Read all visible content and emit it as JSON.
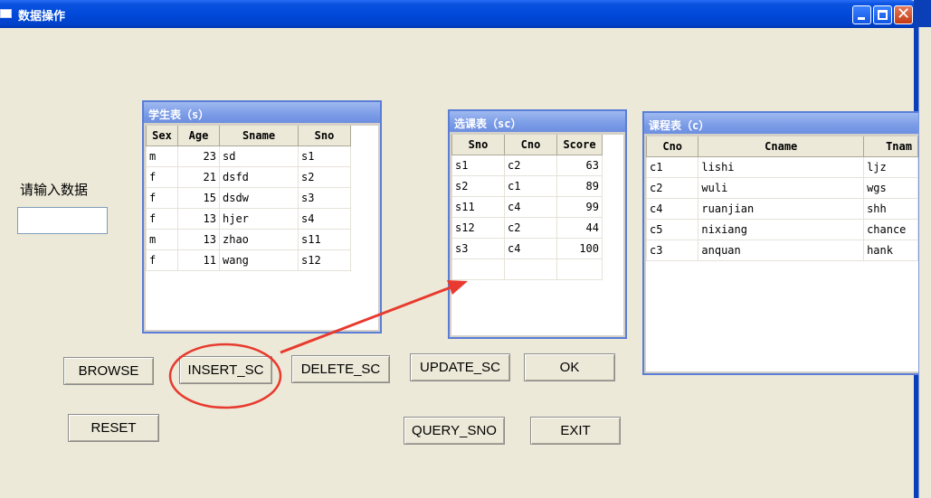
{
  "window": {
    "title": "数据操作"
  },
  "label_input": "请输入数据",
  "student": {
    "title": "学生表（s）",
    "headers": [
      "Sex",
      "Age",
      "Sname",
      "Sno"
    ],
    "rows": [
      [
        "m",
        "23",
        "sd",
        "s1"
      ],
      [
        "f",
        "21",
        "dsfd",
        "s2"
      ],
      [
        "f",
        "15",
        "dsdw",
        "s3"
      ],
      [
        "f",
        "13",
        "hjer",
        "s4"
      ],
      [
        "m",
        "13",
        "zhao",
        "s11"
      ],
      [
        "f",
        "11",
        "wang",
        "s12"
      ]
    ]
  },
  "sc": {
    "title": "选课表（sc）",
    "headers": [
      "Sno",
      "Cno",
      "Score"
    ],
    "rows": [
      [
        "s1",
        "c2",
        "63"
      ],
      [
        "s2",
        "c1",
        "89"
      ],
      [
        "s11",
        "c4",
        "99"
      ],
      [
        "s12",
        "c2",
        "44"
      ],
      [
        "s3",
        "c4",
        "100"
      ],
      [
        "",
        "",
        ""
      ]
    ]
  },
  "course": {
    "title": "课程表（c）",
    "headers": [
      "Cno",
      "Cname",
      "Tnam"
    ],
    "rows": [
      [
        "c1",
        "lishi",
        "ljz"
      ],
      [
        "c2",
        "wuli",
        "wgs"
      ],
      [
        "c4",
        "ruanjian",
        "shh"
      ],
      [
        "c5",
        "nixiang",
        "chance"
      ],
      [
        "c3",
        "anquan",
        "hank"
      ]
    ]
  },
  "buttons": {
    "browse": "BROWSE",
    "insert_sc": "INSERT_SC",
    "delete_sc": "DELETE_SC",
    "update_sc": "UPDATE_SC",
    "ok": "OK",
    "reset": "RESET",
    "query_sno": "QUERY_SNO",
    "exit": "EXIT"
  },
  "annotation_color": "#e83a2e"
}
